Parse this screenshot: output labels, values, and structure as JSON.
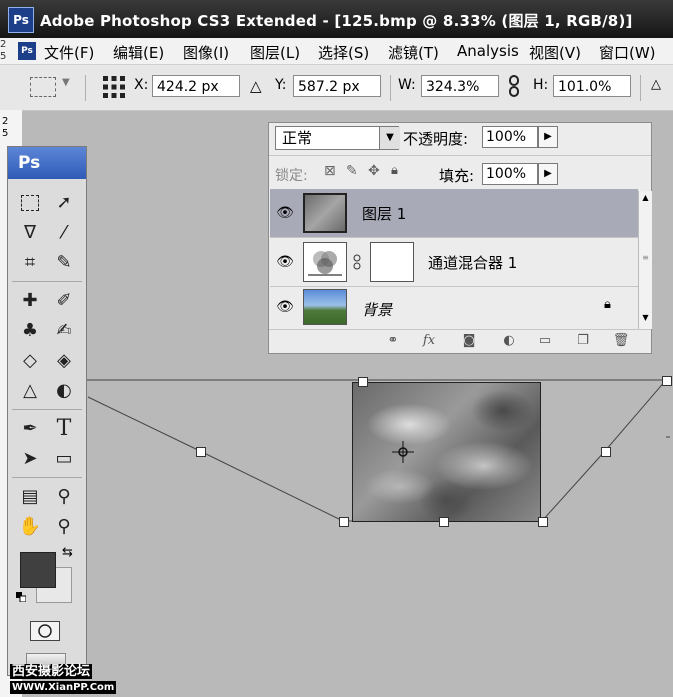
{
  "app": {
    "logo": "Ps",
    "title": "Adobe Photoshop CS3 Extended - [125.bmp @ 8.33% (图层 1, RGB/8)]"
  },
  "menu": {
    "logo": "Ps",
    "items": [
      "文件(F)",
      "编辑(E)",
      "图像(I)",
      "图层(L)",
      "选择(S)",
      "滤镜(T)",
      "Analysis",
      "视图(V)",
      "窗口(W)"
    ]
  },
  "ruler_numbers": [
    "2",
    "5",
    "2",
    "5"
  ],
  "options": {
    "x_label": "X:",
    "x_value": "424.2 px",
    "y_label": "Y:",
    "y_value": "587.2 px",
    "w_label": "W:",
    "w_value": "324.3%",
    "h_label": "H:",
    "h_value": "101.0%"
  },
  "toolbox": {
    "header": "Ps",
    "type_tool": "T"
  },
  "layers_panel": {
    "blend_mode": "正常",
    "opacity_label": "不透明度:",
    "opacity_value": "100%",
    "lock_label": "锁定:",
    "fill_label": "填充:",
    "fill_value": "100%",
    "layers": [
      {
        "name": "图层 1",
        "selected": true
      },
      {
        "name": "通道混合器 1",
        "selected": false
      },
      {
        "name": "背景",
        "selected": false,
        "locked": true
      }
    ],
    "footer_fx": "fx"
  },
  "watermark": {
    "line1": "西安摄影论坛",
    "line2": "WWW.XianPP.Com"
  },
  "colors": {
    "foreground": "#404040",
    "background": "#e8e8e8",
    "selected_layer": "#a9aab8"
  }
}
